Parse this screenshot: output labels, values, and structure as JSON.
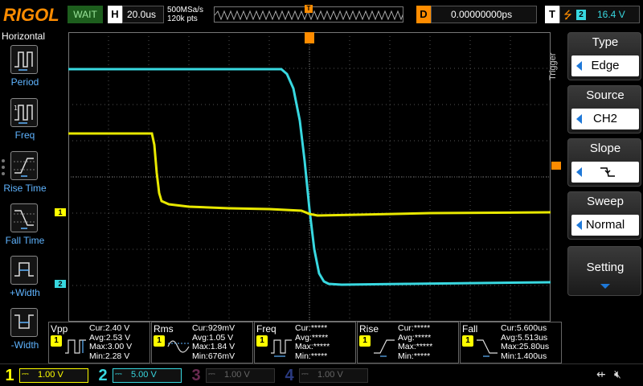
{
  "header": {
    "brand": "RIGOL",
    "run_state": "WAIT",
    "timebase_key": "H",
    "timebase": "20.0us",
    "sample_rate": "500MSa/s",
    "memory_depth": "120k pts",
    "trigger_position_marker": "T",
    "delay_key": "D",
    "delay": "0.00000000ps",
    "trigger_key": "T",
    "trigger_channel": "2",
    "trigger_level": "16.4 V"
  },
  "left_menu": {
    "title": "Horizontal",
    "items": [
      {
        "label": "Period",
        "icon": "period-icon"
      },
      {
        "label": "Freq",
        "icon": "frequency-icon"
      },
      {
        "label": "Rise Time",
        "icon": "rise-time-icon"
      },
      {
        "label": "Fall Time",
        "icon": "fall-time-icon"
      },
      {
        "label": "+Width",
        "icon": "positive-width-icon"
      },
      {
        "label": "-Width",
        "icon": "negative-width-icon"
      }
    ]
  },
  "right_menu": {
    "title": "Trigger",
    "buttons": [
      {
        "head": "Type",
        "value": "Edge"
      },
      {
        "head": "Source",
        "value": "CH2"
      },
      {
        "head": "Slope",
        "value": "",
        "icon": "falling-edge-icon"
      },
      {
        "head": "Sweep",
        "value": "Normal"
      },
      {
        "head": "Setting",
        "value": ""
      }
    ]
  },
  "channel_markers": {
    "ch1": "1",
    "ch2": "2"
  },
  "measurements": [
    {
      "name": "Vpp",
      "channel": "1",
      "cur": "Cur:2.40 V",
      "avg": "Avg:2.53 V",
      "max": "Max:3.00 V",
      "min": "Min:2.28 V"
    },
    {
      "name": "Rms",
      "channel": "1",
      "cur": "Cur:929mV",
      "avg": "Avg:1.05 V",
      "max": "Max:1.84 V",
      "min": "Min:676mV"
    },
    {
      "name": "Freq",
      "channel": "1",
      "cur": "Cur:*****",
      "avg": "Avg:*****",
      "max": "Max:*****",
      "min": "Min:*****"
    },
    {
      "name": "Rise",
      "channel": "1",
      "cur": "Cur:*****",
      "avg": "Avg:*****",
      "max": "Max:*****",
      "min": "Min:*****"
    },
    {
      "name": "Fall",
      "channel": "1",
      "cur": "Cur:5.600us",
      "avg": "Avg:5.513us",
      "max": "Max:25.80us",
      "min": "Min:1.400us"
    }
  ],
  "channels": [
    {
      "num": "1",
      "scale": "1.00 V",
      "color": "#ffff00",
      "active": true
    },
    {
      "num": "2",
      "scale": "5.00 V",
      "color": "#00c8d7",
      "active": true
    },
    {
      "num": "3",
      "scale": "1.00 V",
      "color": "#d04090",
      "active": false
    },
    {
      "num": "4",
      "scale": "1.00 V",
      "color": "#4a70ff",
      "active": false
    }
  ],
  "colors": {
    "ch1": "#ffff00",
    "ch2": "#38d8e0",
    "trigger": "#ff8c00",
    "menu_label": "#5fb4ff"
  }
}
